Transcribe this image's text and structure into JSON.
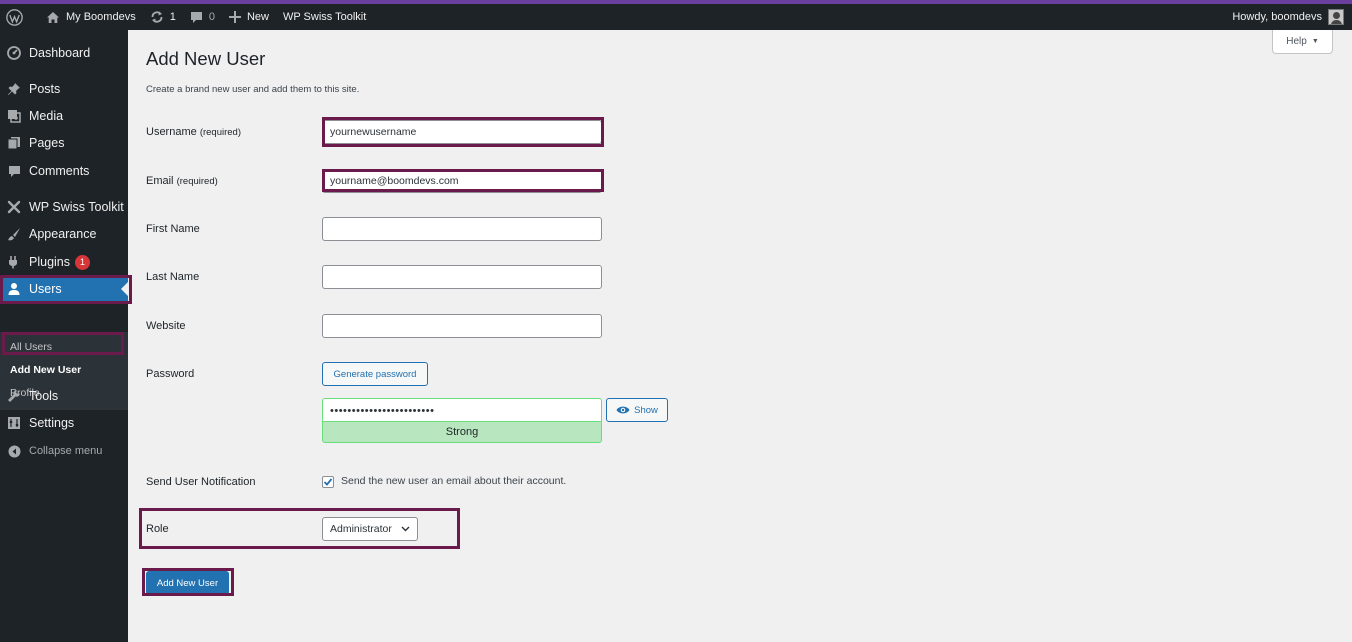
{
  "admin_bar": {
    "site_name": "My Boomdevs",
    "updates_count": "1",
    "comments_count": "0",
    "new_label": "New",
    "toolkit_label": "WP Swiss Toolkit",
    "greeting": "Howdy, boomdevs"
  },
  "sidebar": {
    "items": [
      {
        "label": "Dashboard",
        "icon": "dashboard-icon"
      },
      {
        "label": "Posts",
        "icon": "pin-icon"
      },
      {
        "label": "Media",
        "icon": "media-icon"
      },
      {
        "label": "Pages",
        "icon": "pages-icon"
      },
      {
        "label": "Comments",
        "icon": "comment-icon"
      },
      {
        "label": "WP Swiss Toolkit",
        "icon": "swiss-toolkit-icon"
      },
      {
        "label": "Appearance",
        "icon": "brush-icon"
      },
      {
        "label": "Plugins",
        "icon": "plugin-icon",
        "badge": "1"
      },
      {
        "label": "Users",
        "icon": "user-icon",
        "current": true
      },
      {
        "label": "Tools",
        "icon": "wrench-icon"
      },
      {
        "label": "Settings",
        "icon": "settings-icon"
      }
    ],
    "submenu": [
      {
        "label": "All Users"
      },
      {
        "label": "Add New User",
        "current": true
      },
      {
        "label": "Profile"
      }
    ],
    "collapse_label": "Collapse menu"
  },
  "help": {
    "label": "Help"
  },
  "page": {
    "title": "Add New User",
    "description": "Create a brand new user and add them to this site."
  },
  "form": {
    "username": {
      "label": "Username",
      "required": "(required)",
      "value": "yournewusername"
    },
    "email": {
      "label": "Email",
      "required": "(required)",
      "value": "yourname@boomdevs.com"
    },
    "first_name": {
      "label": "First Name",
      "value": ""
    },
    "last_name": {
      "label": "Last Name",
      "value": ""
    },
    "website": {
      "label": "Website",
      "value": ""
    },
    "password": {
      "label": "Password",
      "generate_label": "Generate password",
      "value": "••••••••••••••••••••••••",
      "show_label": "Show",
      "strength": "Strong"
    },
    "notification": {
      "label": "Send User Notification",
      "checkbox_label": "Send the new user an email about their account.",
      "checked": true
    },
    "role": {
      "label": "Role",
      "value": "Administrator"
    },
    "submit_label": "Add New User"
  },
  "colors": {
    "admin_bg": "#1d2327",
    "accent": "#2271b1",
    "highlight_border": "#6b1a4c",
    "strength_bg": "#b8e6bf"
  }
}
